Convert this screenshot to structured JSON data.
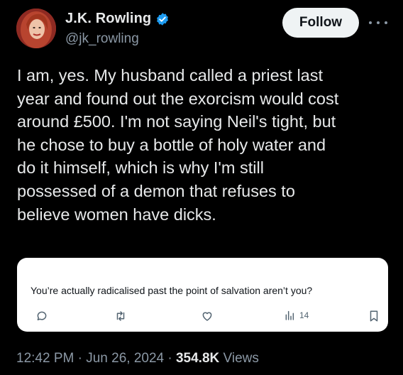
{
  "author": {
    "display_name": "J.K. Rowling",
    "handle": "@jk_rowling",
    "verified": true
  },
  "follow_label": "Follow",
  "tweet_text": "I am, yes. My husband called a priest last\nyear and found out the exorcism would cost\naround £500. I'm not saying Neil's tight, but\nhe chose to buy a bottle of holy water and\ndo it himself, which is why I'm still\npossessed of a demon that refuses to\nbelieve women have dicks.",
  "quoted_post": {
    "text": "You’re actually radicalised past the point of salvation aren’t you?",
    "views_count": "14",
    "icons": [
      "reply-icon",
      "retweet-icon",
      "like-icon",
      "views-icon",
      "bookmark-icon"
    ]
  },
  "meta": {
    "time": "12:42 PM",
    "date": "Jun 26, 2024",
    "views_number": "354.8K",
    "views_label": "Views",
    "separator": "·"
  },
  "colors": {
    "background": "#000000",
    "primary_text": "#e7e9ea",
    "secondary_text": "#8b98a5",
    "verified_blue": "#1d9bf0",
    "follow_bg": "#eff3f4"
  }
}
